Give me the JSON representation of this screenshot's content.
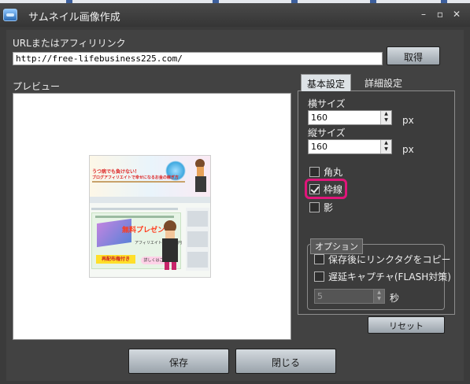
{
  "window": {
    "title": "サムネイル画像作成",
    "controls": {
      "minimize": "–",
      "maximize": "▫",
      "close": "✕"
    }
  },
  "url": {
    "label": "URLまたはアフィリリンク",
    "value": "http://free-lifebusiness225.com/",
    "fetch_button": "取得"
  },
  "preview": {
    "label": "プレビュー",
    "thumb": {
      "headline1": "うつ病でも負けない！",
      "headline2": "ブログアフィリエイトで幸せになるお金の稼ぎ方",
      "present": "無料プレゼント",
      "sample": "アフィリエイトで１５万円",
      "banner": "再配布権付き",
      "badge": "詳しくはこちら"
    }
  },
  "tabs": {
    "basic": "基本設定",
    "detail": "詳細設定"
  },
  "basic": {
    "width_label": "横サイズ",
    "width_value": "160",
    "width_unit": "px",
    "height_label": "縦サイズ",
    "height_value": "160",
    "height_unit": "px",
    "rounded_label": "角丸",
    "rounded_checked": false,
    "border_label": "枠線",
    "border_checked": true,
    "shadow_label": "影",
    "shadow_checked": false
  },
  "options": {
    "title": "オプション",
    "copy_link_label": "保存後にリンクタグをコピー",
    "copy_link_checked": false,
    "delay_capture_label": "遅延キャプチャ(FLASH対策)",
    "delay_capture_checked": false,
    "delay_value": "5",
    "delay_unit": "秒"
  },
  "buttons": {
    "reset": "リセット",
    "save": "保存",
    "close": "閉じる"
  },
  "colors": {
    "highlight": "#e0157a",
    "window_bg": "#3b3b3b"
  }
}
